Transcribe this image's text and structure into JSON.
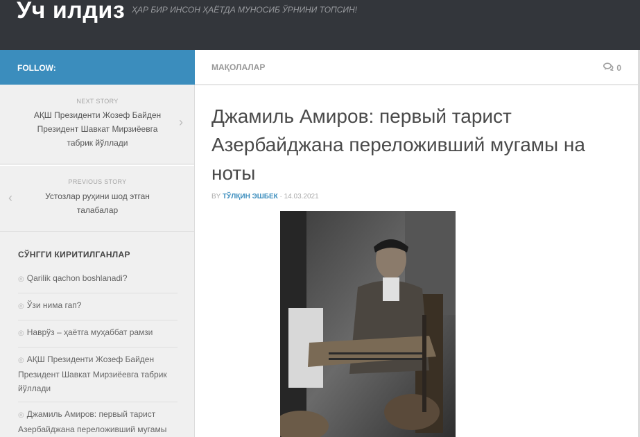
{
  "site": {
    "title": "Уч илдиз",
    "tagline": "ҲАР БИР ИНСОН ҲАЁТДА МУНОСИБ ЎРНИНИ ТОПСИН!"
  },
  "follow": {
    "label": "FOLLOW:"
  },
  "topbar": {
    "category": "МАҚОЛАЛАР",
    "comment_count": "0",
    "comment_icon": "speech-bubbles-icon"
  },
  "next_story": {
    "kicker": "NEXT STORY",
    "title": "АҚШ Президенти Жозеф Байден Президент Шавкат Мирзиёевга табрик йўллади"
  },
  "previous_story": {
    "kicker": "PREVIOUS STORY",
    "title": "Устозлар руҳини шод этган талабалар"
  },
  "recent": {
    "title": "СЎНГГИ КИРИТИЛГАНЛАР",
    "items": [
      {
        "label": "Qarilik qachon boshlanadi?"
      },
      {
        "label": "Ўзи нима гап?"
      },
      {
        "label": "Наврўз – ҳаётга муҳаббат рамзи"
      },
      {
        "label": "АҚШ Президенти Жозеф Байден Президент Шавкат Мирзиёевга табрик йўллади"
      },
      {
        "label": "Джамиль Амиров: первый тарист Азербайджана переложивший мугамы на ноты"
      }
    ]
  },
  "post": {
    "title": "Джамиль Амиров: первый тарист Азербайджана переложивший мугамы на ноты",
    "by_prefix": "BY",
    "author": "ТЎЛҚИН ЭШБЕК",
    "date": "· 14.03.2021"
  },
  "colors": {
    "header_bg": "#33363b",
    "accent": "#3b8dbd"
  }
}
